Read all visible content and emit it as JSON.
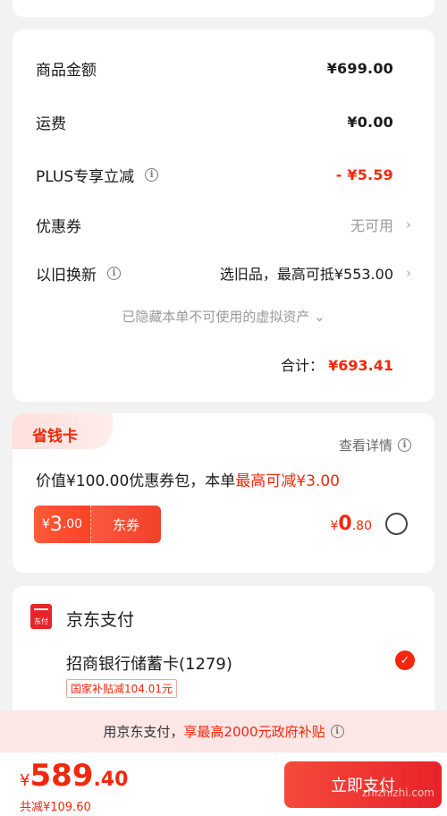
{
  "summary": {
    "goods_amount_label": "商品金额",
    "goods_amount_value": "¥699.00",
    "shipping_label": "运费",
    "shipping_value": "¥0.00",
    "plus_label": "PLUS专享立减",
    "plus_value": "- ¥5.59",
    "coupon_label": "优惠券",
    "coupon_value": "无可用",
    "tradein_label": "以旧换新",
    "tradein_value": "选旧品，最高可抵¥553.00",
    "hidden_note": "已隐藏本单不可使用的虚拟资产",
    "total_label": "合计：",
    "total_value": "¥693.41"
  },
  "saving_card": {
    "tab_label": "省钱卡",
    "detail_link": "查看详情",
    "desc_prefix": "价值¥100.00优惠券包，本单",
    "desc_highlight": "最高可减¥3.00",
    "coupon_currency": "¥",
    "coupon_int": "3",
    "coupon_dec": ".00",
    "coupon_tag": "东券",
    "price_currency": "¥",
    "price_int": "0",
    "price_dec": ".80"
  },
  "payment": {
    "icon_text": "东付",
    "title": "京东支付",
    "bank": "招商银行储蓄卡(1279)",
    "subsidy_tag": "国家补贴减104.01元"
  },
  "banner": {
    "prefix": "用京东支付，",
    "highlight": "享最高2000元政府补贴"
  },
  "bottom": {
    "currency": "¥",
    "price_int": "589",
    "price_dec": ".40",
    "reduce_text": "共减¥109.60",
    "pay_button": "立即支付",
    "watermark": "zhizhizhi.com"
  },
  "colors": {
    "accent": "#f2270c",
    "banner_bg": "#fde6e6"
  }
}
